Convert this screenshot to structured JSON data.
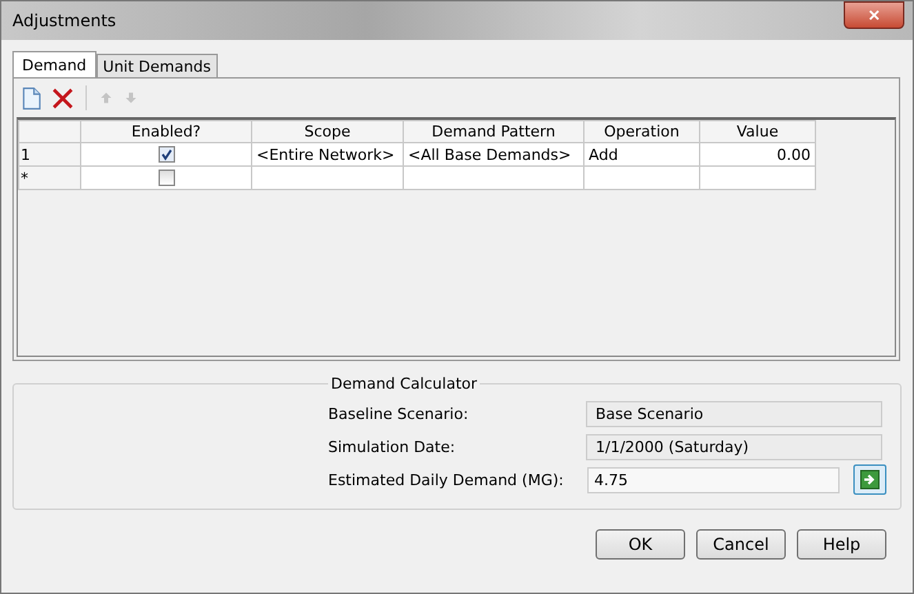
{
  "window": {
    "title": "Adjustments",
    "close": "✕"
  },
  "tabs": [
    {
      "label": "Demand",
      "selected": true
    },
    {
      "label": "Unit Demands",
      "selected": false
    }
  ],
  "toolbar": [
    {
      "kind": "new",
      "disabled": false
    },
    {
      "kind": "delete",
      "disabled": false
    },
    {
      "kind": "up",
      "disabled": true
    },
    {
      "kind": "down",
      "disabled": true
    }
  ],
  "table": {
    "columns": [
      "Enabled?",
      "Scope",
      "Demand Pattern",
      "Operation",
      "Value"
    ],
    "rows": [
      {
        "header": "1",
        "enabled": true,
        "scope": "<Entire Network>",
        "demand_pattern": "<All Base Demands>",
        "operation": "Add",
        "value": "0.00"
      },
      {
        "header": "*",
        "enabled": false,
        "scope": "",
        "demand_pattern": "",
        "operation": "",
        "value": ""
      }
    ]
  },
  "calculator": {
    "title": "Demand Calculator",
    "fields": [
      {
        "label": "Baseline Scenario:",
        "value": "Base Scenario",
        "kind": "readonly"
      },
      {
        "label": "Simulation Date:",
        "value": "1/1/2000 (Saturday)",
        "kind": "readonly"
      },
      {
        "label": "Estimated Daily Demand (MG):",
        "value": "4.75",
        "kind": "editable"
      }
    ]
  },
  "buttons": [
    "OK",
    "Cancel",
    "Help"
  ]
}
